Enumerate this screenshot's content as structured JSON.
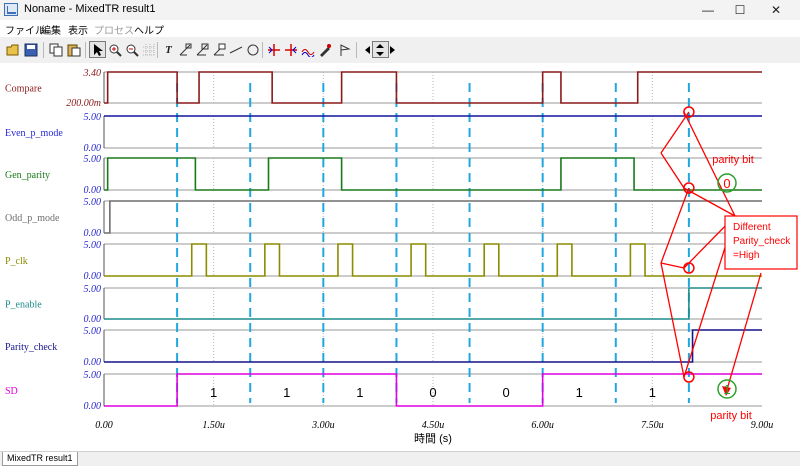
{
  "window": {
    "title": "Noname - MixedTR result1",
    "minimize": "—",
    "maximize": "☐",
    "close": "✕"
  },
  "menu": [
    {
      "label": "ファイル",
      "enabled": true
    },
    {
      "label": "編集",
      "enabled": true
    },
    {
      "label": "表示",
      "enabled": true
    },
    {
      "label": "プロセス",
      "enabled": false
    },
    {
      "label": "ヘルプ",
      "enabled": true
    }
  ],
  "toolbar": [
    {
      "icon": "open-folder-icon"
    },
    {
      "icon": "save-icon"
    },
    {
      "icon": "copy-icon"
    },
    {
      "icon": "paste-icon"
    },
    {
      "icon": "select-arrow-icon",
      "selected": true
    },
    {
      "icon": "zoom-in-icon"
    },
    {
      "icon": "zoom-out-icon"
    },
    {
      "icon": "grid-icon"
    },
    {
      "icon": "text-tool-icon"
    },
    {
      "icon": "label-tool-icon"
    },
    {
      "icon": "label-tool-2-icon"
    },
    {
      "icon": "label-tool-3-icon"
    },
    {
      "icon": "line-tool-icon"
    },
    {
      "icon": "circle-tool-icon"
    },
    {
      "icon": "cursor-1-icon"
    },
    {
      "icon": "cursor-2-icon"
    },
    {
      "icon": "wave-tool-icon"
    },
    {
      "icon": "pencil-tool-icon"
    },
    {
      "icon": "flag-tool-icon"
    },
    {
      "icon": "arrow-left-icon"
    },
    {
      "icon": "arrow-updown-icon"
    },
    {
      "icon": "arrow-right-icon"
    }
  ],
  "colors": {
    "compare": "#8b1a1a",
    "even": "#1414a0",
    "gen": "#1a7a1a",
    "odd": "#6e6e6e",
    "pclk": "#8c8c00",
    "penable": "#1e8c8c",
    "parity": "#14148c",
    "sd": "#e000e0",
    "bluelabel": "#2828d2",
    "guide": "#21a7e0",
    "annotation": "#ff0000",
    "highlight": "#2ca02c"
  },
  "chart_data": {
    "type": "line",
    "xlabel": "時間 (s)",
    "x_ticks": [
      "0.00",
      "1.50u",
      "3.00u",
      "4.50u",
      "6.00u",
      "7.50u",
      "9.00u"
    ],
    "xlim": [
      0,
      9
    ],
    "x_unit": "us",
    "dashed_guides_us": [
      1.0,
      2.0,
      3.0,
      4.0,
      5.0,
      6.0,
      7.0,
      8.0
    ],
    "series": [
      {
        "name": "Compare",
        "ymax": "3.40",
        "ymin": "200.00m",
        "hi": 3.4,
        "lo": 0.2,
        "name_color_key": "compare",
        "color_key": "compare",
        "steps": [
          [
            0,
            0.2
          ],
          [
            0.05,
            3.4
          ],
          [
            1.0,
            0.2
          ],
          [
            1.3,
            3.4
          ],
          [
            2.3,
            0.2
          ],
          [
            3.25,
            3.4
          ],
          [
            4.0,
            0.2
          ],
          [
            6.0,
            3.4
          ],
          [
            6.25,
            0.2
          ],
          [
            7.3,
            3.4
          ],
          [
            9,
            3.4
          ]
        ]
      },
      {
        "name": "Even_p_mode",
        "ymax": "5.00",
        "ymin": "0.00",
        "hi": 5,
        "lo": 0,
        "name_color_key": "bluelabel",
        "color_key": "even",
        "steps": [
          [
            0,
            5
          ],
          [
            9,
            5
          ]
        ]
      },
      {
        "name": "Gen_parity",
        "ymax": "5.00",
        "ymin": "0.00",
        "hi": 5,
        "lo": 0,
        "name_color_key": "gen",
        "color_key": "gen",
        "steps": [
          [
            0,
            0
          ],
          [
            0.05,
            5
          ],
          [
            1.25,
            0
          ],
          [
            2.25,
            5
          ],
          [
            3.25,
            0
          ],
          [
            6.25,
            5
          ],
          [
            7.25,
            0
          ],
          [
            9,
            0
          ]
        ]
      },
      {
        "name": "Odd_p_mode",
        "ymax": "5.00",
        "ymin": "0.00",
        "hi": 5,
        "lo": 0,
        "name_color_key": "odd",
        "color_key": "odd",
        "steps": [
          [
            0,
            0
          ],
          [
            0.08,
            5
          ],
          [
            9,
            5
          ]
        ]
      },
      {
        "name": "P_clk",
        "ymax": "5.00",
        "ymin": "0.00",
        "hi": 5,
        "lo": 0,
        "name_color_key": "pclk",
        "color_key": "pclk",
        "steps": [
          [
            0,
            0
          ],
          [
            1.2,
            5
          ],
          [
            1.4,
            0
          ],
          [
            2.2,
            5
          ],
          [
            2.4,
            0
          ],
          [
            3.2,
            5
          ],
          [
            3.4,
            0
          ],
          [
            4.2,
            5
          ],
          [
            4.4,
            0
          ],
          [
            5.2,
            5
          ],
          [
            5.4,
            0
          ],
          [
            6.2,
            5
          ],
          [
            6.4,
            0
          ],
          [
            7.2,
            5
          ],
          [
            7.4,
            0
          ],
          [
            9,
            0
          ]
        ]
      },
      {
        "name": "P_enable",
        "ymax": "5.00",
        "ymin": "0.00",
        "hi": 5,
        "lo": 0,
        "name_color_key": "penable",
        "color_key": "penable",
        "steps": [
          [
            0,
            0
          ],
          [
            8.0,
            5
          ],
          [
            9,
            5
          ]
        ]
      },
      {
        "name": "Parity_check",
        "ymax": "5.00",
        "ymin": "0.00",
        "hi": 5,
        "lo": 0,
        "name_color_key": "parity",
        "color_key": "parity",
        "steps": [
          [
            0,
            0
          ],
          [
            8.05,
            5
          ],
          [
            9,
            5
          ]
        ]
      },
      {
        "name": "SD",
        "ymax": "5.00",
        "ymin": "0.00",
        "hi": 5,
        "lo": 0,
        "name_color_key": "sd",
        "color_key": "sd",
        "steps": [
          [
            0,
            0
          ],
          [
            1.0,
            5
          ],
          [
            4.0,
            0
          ],
          [
            6.0,
            5
          ],
          [
            9,
            5
          ]
        ]
      }
    ],
    "sd_bits": [
      {
        "x": 1.5,
        "bit": "1"
      },
      {
        "x": 2.5,
        "bit": "1"
      },
      {
        "x": 3.5,
        "bit": "1"
      },
      {
        "x": 4.5,
        "bit": "0"
      },
      {
        "x": 5.5,
        "bit": "0"
      },
      {
        "x": 6.5,
        "bit": "1"
      },
      {
        "x": 7.5,
        "bit": "1"
      }
    ],
    "annotations": {
      "parity_bit_label_1": "parity bit",
      "parity_bit_value_1": "0",
      "parity_bit_label_2": "parity bit",
      "parity_bit_value_2": "1",
      "callout_lines": [
        "Different",
        "Parity_check",
        "=High"
      ]
    }
  },
  "status": {
    "tab": "MixedTR result1"
  }
}
